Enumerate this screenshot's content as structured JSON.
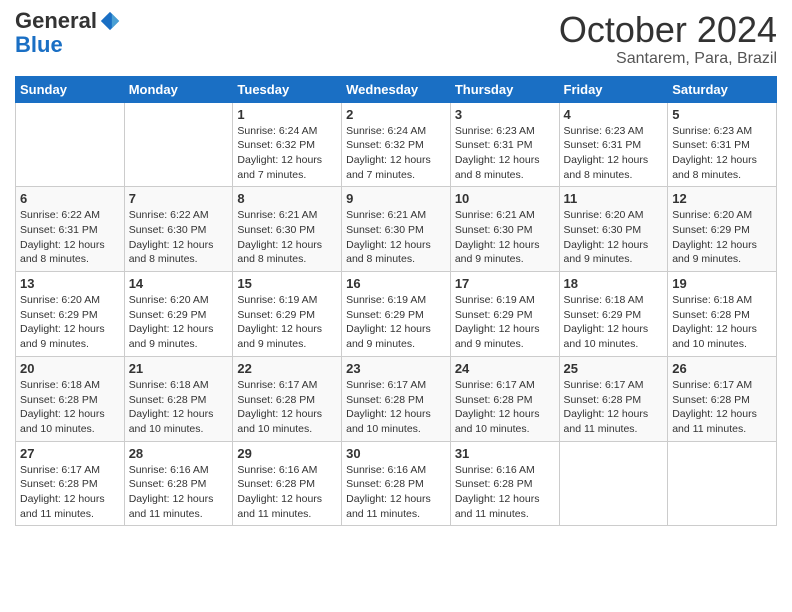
{
  "header": {
    "logo_general": "General",
    "logo_blue": "Blue",
    "month": "October 2024",
    "location": "Santarem, Para, Brazil"
  },
  "days_of_week": [
    "Sunday",
    "Monday",
    "Tuesday",
    "Wednesday",
    "Thursday",
    "Friday",
    "Saturday"
  ],
  "weeks": [
    [
      null,
      null,
      {
        "day": 1,
        "sunrise": "6:24 AM",
        "sunset": "6:32 PM",
        "daylight": "12 hours and 7 minutes."
      },
      {
        "day": 2,
        "sunrise": "6:24 AM",
        "sunset": "6:32 PM",
        "daylight": "12 hours and 7 minutes."
      },
      {
        "day": 3,
        "sunrise": "6:23 AM",
        "sunset": "6:31 PM",
        "daylight": "12 hours and 8 minutes."
      },
      {
        "day": 4,
        "sunrise": "6:23 AM",
        "sunset": "6:31 PM",
        "daylight": "12 hours and 8 minutes."
      },
      {
        "day": 5,
        "sunrise": "6:23 AM",
        "sunset": "6:31 PM",
        "daylight": "12 hours and 8 minutes."
      }
    ],
    [
      {
        "day": 6,
        "sunrise": "6:22 AM",
        "sunset": "6:31 PM",
        "daylight": "12 hours and 8 minutes."
      },
      {
        "day": 7,
        "sunrise": "6:22 AM",
        "sunset": "6:30 PM",
        "daylight": "12 hours and 8 minutes."
      },
      {
        "day": 8,
        "sunrise": "6:21 AM",
        "sunset": "6:30 PM",
        "daylight": "12 hours and 8 minutes."
      },
      {
        "day": 9,
        "sunrise": "6:21 AM",
        "sunset": "6:30 PM",
        "daylight": "12 hours and 8 minutes."
      },
      {
        "day": 10,
        "sunrise": "6:21 AM",
        "sunset": "6:30 PM",
        "daylight": "12 hours and 9 minutes."
      },
      {
        "day": 11,
        "sunrise": "6:20 AM",
        "sunset": "6:30 PM",
        "daylight": "12 hours and 9 minutes."
      },
      {
        "day": 12,
        "sunrise": "6:20 AM",
        "sunset": "6:29 PM",
        "daylight": "12 hours and 9 minutes."
      }
    ],
    [
      {
        "day": 13,
        "sunrise": "6:20 AM",
        "sunset": "6:29 PM",
        "daylight": "12 hours and 9 minutes."
      },
      {
        "day": 14,
        "sunrise": "6:20 AM",
        "sunset": "6:29 PM",
        "daylight": "12 hours and 9 minutes."
      },
      {
        "day": 15,
        "sunrise": "6:19 AM",
        "sunset": "6:29 PM",
        "daylight": "12 hours and 9 minutes."
      },
      {
        "day": 16,
        "sunrise": "6:19 AM",
        "sunset": "6:29 PM",
        "daylight": "12 hours and 9 minutes."
      },
      {
        "day": 17,
        "sunrise": "6:19 AM",
        "sunset": "6:29 PM",
        "daylight": "12 hours and 9 minutes."
      },
      {
        "day": 18,
        "sunrise": "6:18 AM",
        "sunset": "6:29 PM",
        "daylight": "12 hours and 10 minutes."
      },
      {
        "day": 19,
        "sunrise": "6:18 AM",
        "sunset": "6:28 PM",
        "daylight": "12 hours and 10 minutes."
      }
    ],
    [
      {
        "day": 20,
        "sunrise": "6:18 AM",
        "sunset": "6:28 PM",
        "daylight": "12 hours and 10 minutes."
      },
      {
        "day": 21,
        "sunrise": "6:18 AM",
        "sunset": "6:28 PM",
        "daylight": "12 hours and 10 minutes."
      },
      {
        "day": 22,
        "sunrise": "6:17 AM",
        "sunset": "6:28 PM",
        "daylight": "12 hours and 10 minutes."
      },
      {
        "day": 23,
        "sunrise": "6:17 AM",
        "sunset": "6:28 PM",
        "daylight": "12 hours and 10 minutes."
      },
      {
        "day": 24,
        "sunrise": "6:17 AM",
        "sunset": "6:28 PM",
        "daylight": "12 hours and 10 minutes."
      },
      {
        "day": 25,
        "sunrise": "6:17 AM",
        "sunset": "6:28 PM",
        "daylight": "12 hours and 11 minutes."
      },
      {
        "day": 26,
        "sunrise": "6:17 AM",
        "sunset": "6:28 PM",
        "daylight": "12 hours and 11 minutes."
      }
    ],
    [
      {
        "day": 27,
        "sunrise": "6:17 AM",
        "sunset": "6:28 PM",
        "daylight": "12 hours and 11 minutes."
      },
      {
        "day": 28,
        "sunrise": "6:16 AM",
        "sunset": "6:28 PM",
        "daylight": "12 hours and 11 minutes."
      },
      {
        "day": 29,
        "sunrise": "6:16 AM",
        "sunset": "6:28 PM",
        "daylight": "12 hours and 11 minutes."
      },
      {
        "day": 30,
        "sunrise": "6:16 AM",
        "sunset": "6:28 PM",
        "daylight": "12 hours and 11 minutes."
      },
      {
        "day": 31,
        "sunrise": "6:16 AM",
        "sunset": "6:28 PM",
        "daylight": "12 hours and 11 minutes."
      },
      null,
      null
    ]
  ]
}
